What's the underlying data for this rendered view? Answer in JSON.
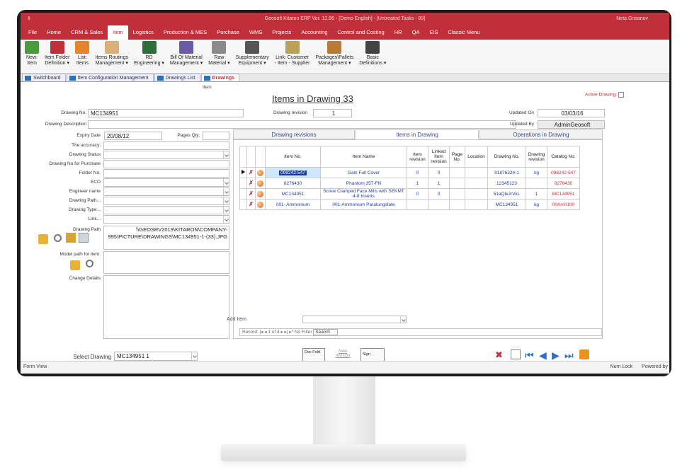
{
  "window": {
    "title": "Geosoft Kitaron ERP Ver. 12.86 - [Demo English] - [Untreated Tasks - 89]",
    "user": "Neta Grisanov",
    "quick_access": "⇕"
  },
  "menu": [
    "File",
    "Home",
    "CRM & Sales",
    "Item",
    "Logistics",
    "Production & MES",
    "Purchase",
    "WMS",
    "Projects",
    "Accounting",
    "Control and Costing",
    "HR",
    "QA",
    "EIS",
    "Classic Menu"
  ],
  "menu_active": "Item",
  "ribbon": {
    "buttons": [
      {
        "label1": "New:",
        "label2": "Item",
        "icon": "leaf-group-icon",
        "color": "#4a9a3e"
      },
      {
        "label1": "Item Folder",
        "label2": "Definition ▾",
        "icon": "folder-icon",
        "color": "#c0303a"
      },
      {
        "label1": "List:",
        "label2": "Items",
        "icon": "box-list-icon",
        "color": "#e3862a"
      },
      {
        "label1": "Items Routings",
        "label2": "Management ▾",
        "icon": "routing-icon",
        "color": "#d9b07a"
      },
      {
        "label1": "RD",
        "label2": "Engineering ▾",
        "icon": "circuit-board-icon",
        "color": "#2f6e3a"
      },
      {
        "label1": "Bill Of Material",
        "label2": "Management ▾",
        "icon": "bom-icon",
        "color": "#6a5aa8"
      },
      {
        "label1": "Raw",
        "label2": "Material ▾",
        "icon": "raw-material-icon",
        "color": "#8a8a8a"
      },
      {
        "label1": "Supplementary",
        "label2": "Equipment ▾",
        "icon": "gear-equipment-icon",
        "color": "#555"
      },
      {
        "label1": "Link: Customer",
        "label2": "- Item - Supplier",
        "icon": "link-icon",
        "color": "#b9a15a"
      },
      {
        "label1": "Packages\\Pallets",
        "label2": "Management ▾",
        "icon": "package-icon",
        "color": "#b87a34"
      },
      {
        "label1": "Basic",
        "label2": "Definitions ▾",
        "icon": "hierarchy-icon",
        "color": "#444"
      }
    ],
    "group_label": "Item"
  },
  "doc_tabs": [
    "Switchboard",
    "Item Configuration Management",
    "Drawings List",
    "Drawings"
  ],
  "form": {
    "heading": "Items in Drawing 33",
    "active_drawing_label": "Active Drawing:",
    "drawing_no_label": "Drawing No.",
    "drawing_no": "MC134951",
    "drawing_revision_label": "Drawing revision",
    "drawing_revision": "1",
    "updated_on_label": "Updated On",
    "updated_on": "03/03/16",
    "drawing_description_label": "Drawing Description",
    "updated_by_label": "Updated By",
    "updated_by": "AdminGeosoft",
    "expiry_date_label": "Expiry Date",
    "expiry_date": "20/08/12",
    "pages_qty_label": "Pages Qty.",
    "fields": [
      "The accuracy:",
      "Drawing Status",
      "Drawing No.for Purchase",
      "Folder No.",
      "ECO",
      "Engineer name",
      "Drawing Path...",
      "Drawing Type...",
      "Link..."
    ],
    "drawing_path_label": "Drawing Path",
    "drawing_path_value": "\\\\GEOSRV2019\\KITARON\\COMPANY-995\\PICTURE\\DRAWINGS\\MC134951-1-(33).JPG",
    "model_path_label": "Model path for item:",
    "change_details_label": "Change Details",
    "select_drawing_label": "Select Drawing",
    "select_drawing_value": "MC134951 1",
    "doc_fold_label": "Doc Fold",
    "new_revision_label": "New revision",
    "sign_label": "Sign"
  },
  "subtabs": [
    "Drawing revisions",
    "Items in Drawing",
    "Operations in Drawing"
  ],
  "subtab_active": 1,
  "grid": {
    "columns": [
      "Item No.",
      "Item Name",
      "Item revision",
      "Linked Item revision",
      "Page No.",
      "Location",
      "Drawing No.",
      "Drawing revision",
      "Catalog No."
    ],
    "rows": [
      [
        "098242-547",
        "Gain Full Cover",
        "0",
        "0",
        "",
        "",
        "91876324-1",
        "kg",
        "098242-547"
      ],
      [
        "8276430",
        "Phantom 357-FN",
        "1",
        "1",
        "",
        "",
        "12345123",
        "",
        "8276430"
      ],
      [
        "MC134951",
        "Screw Clamped Face Mills with SEKMT 4-8 Inserts",
        "0",
        "0",
        "",
        "",
        "51aQleJrVkL",
        "1",
        "MC134951"
      ],
      [
        "001- Ammonium",
        "001-Ammonium Paratungstate",
        "",
        "",
        "",
        "",
        "MC134951",
        "kg",
        "00Am0100"
      ]
    ],
    "add_item_label": "Add Item",
    "record_label": "Record:",
    "record_pos": "1 of 4",
    "no_filter": "No Filter",
    "search": "Search"
  },
  "status": {
    "left": "Form View",
    "num_lock": "Num Lock",
    "powered": "Powered by"
  },
  "colors": {
    "brand": "#c0303a",
    "link": "#233ca0"
  }
}
